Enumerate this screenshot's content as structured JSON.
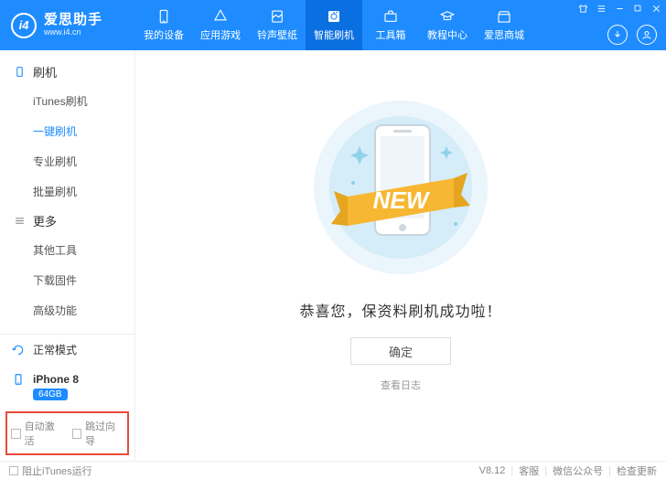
{
  "app": {
    "name": "爱思助手",
    "url": "www.i4.cn"
  },
  "nav": {
    "items": [
      {
        "label": "我的设备"
      },
      {
        "label": "应用游戏"
      },
      {
        "label": "铃声壁纸"
      },
      {
        "label": "智能刷机"
      },
      {
        "label": "工具箱"
      },
      {
        "label": "教程中心"
      },
      {
        "label": "爱思商城"
      }
    ],
    "active_index": 3
  },
  "sidebar": {
    "groups": [
      {
        "title": "刷机",
        "items": [
          {
            "label": "iTunes刷机"
          },
          {
            "label": "一键刷机"
          },
          {
            "label": "专业刷机"
          },
          {
            "label": "批量刷机"
          }
        ],
        "active_index": 1
      },
      {
        "title": "更多",
        "items": [
          {
            "label": "其他工具"
          },
          {
            "label": "下载固件"
          },
          {
            "label": "高级功能"
          }
        ]
      }
    ],
    "mode": "正常模式",
    "device": {
      "name": "iPhone 8",
      "storage": "64GB"
    },
    "options": {
      "auto_activate": "自动激活",
      "skip_guide": "跳过向导"
    }
  },
  "main": {
    "banner_text": "NEW",
    "congrats": "恭喜您，保资料刷机成功啦！",
    "ok": "确定",
    "view_log": "查看日志"
  },
  "footer": {
    "block_itunes": "阻止iTunes运行",
    "version": "V8.12",
    "support": "客服",
    "wechat": "微信公众号",
    "check_update": "检查更新"
  }
}
